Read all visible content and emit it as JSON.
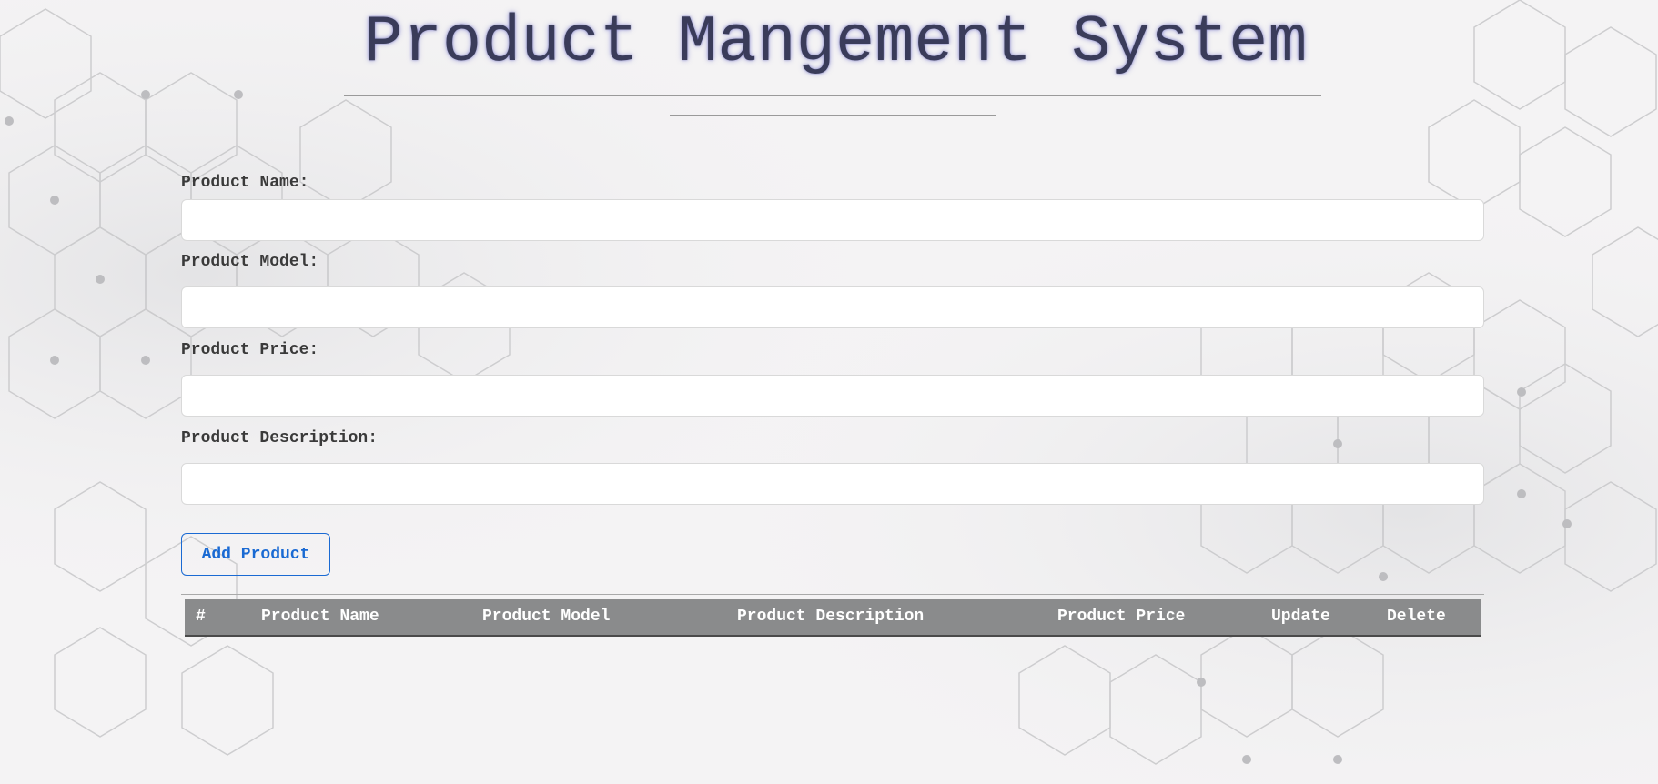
{
  "app": {
    "title": "Product Mangement System"
  },
  "form": {
    "name_label": "Product Name:",
    "name_value": "",
    "model_label": "Product Model:",
    "model_value": "",
    "price_label": "Product Price:",
    "price_value": "",
    "description_label": "Product Description:",
    "description_value": "",
    "add_button_label": "Add Product",
    "add_button_color": "#1a6ad3"
  },
  "table": {
    "columns": [
      "#",
      "Product Name",
      "Product Model",
      "Product Description",
      "Product Price",
      "Update",
      "Delete"
    ],
    "header_bg": "#8a8b8c",
    "rows": []
  },
  "colors": {
    "background": "#f4f3f4",
    "title": "#3a3c5a"
  }
}
